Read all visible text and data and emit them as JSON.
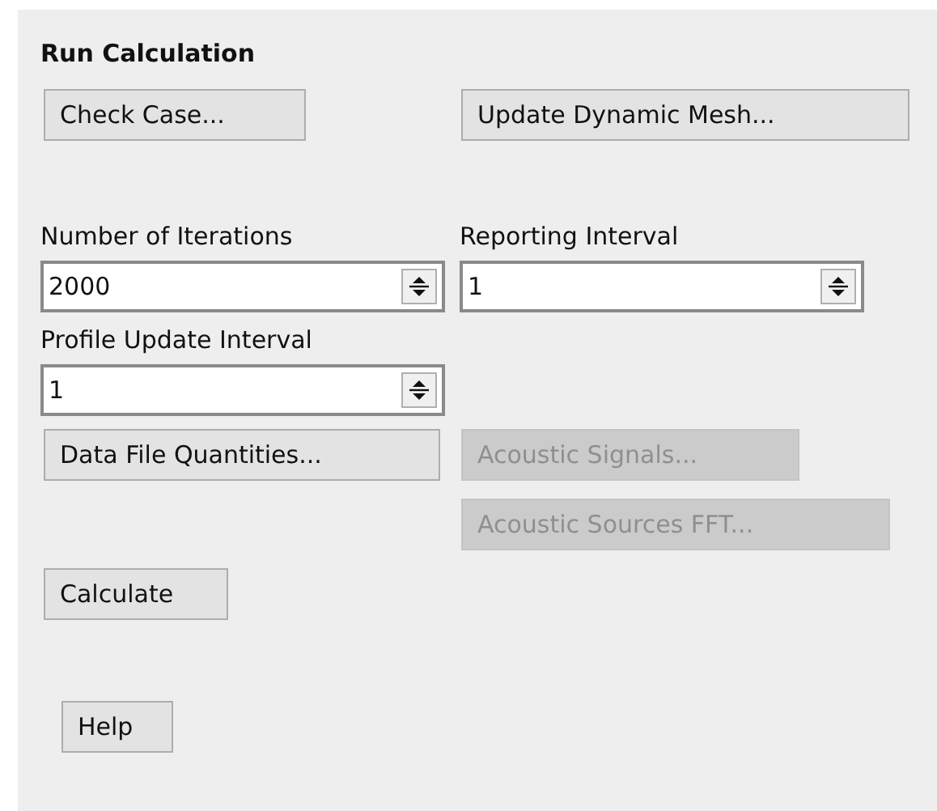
{
  "title": "Run Calculation",
  "top_buttons": [
    {
      "label": "Check Case...",
      "disabled": false
    },
    {
      "label": "Update Dynamic Mesh...",
      "disabled": false
    }
  ],
  "fields": [
    {
      "label": "Number of Iterations",
      "value": "2000"
    },
    {
      "label": "Reporting Interval",
      "value": "1"
    },
    {
      "label": "Profile Update Interval",
      "value": "1"
    }
  ],
  "data_buttons": [
    {
      "label": "Data File Quantities...",
      "disabled": false
    },
    {
      "label": "Acoustic Signals...",
      "disabled": true
    },
    {
      "label": "Acoustic Sources FFT...",
      "disabled": true
    }
  ],
  "calculate_button": {
    "label": "Calculate",
    "disabled": false
  },
  "help_button": {
    "label": "Help",
    "disabled": false
  }
}
